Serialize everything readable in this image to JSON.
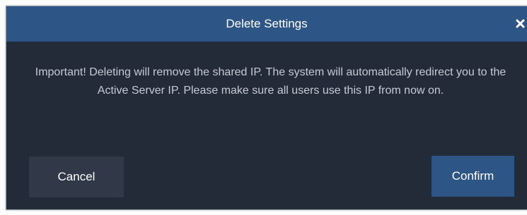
{
  "dialog": {
    "title": "Delete Settings",
    "message": "Important! Deleting will remove the shared IP. The system will automatically redirect you to the Active Server IP. Please make sure all users use this IP from now on.",
    "cancel_label": "Cancel",
    "confirm_label": "Confirm",
    "close_icon": "close-icon"
  },
  "colors": {
    "titlebar": "#2d5585",
    "body_background": "#232b39",
    "cancel_button": "#313847",
    "confirm_button": "#2d5585",
    "message_text": "#c6cbd3"
  }
}
